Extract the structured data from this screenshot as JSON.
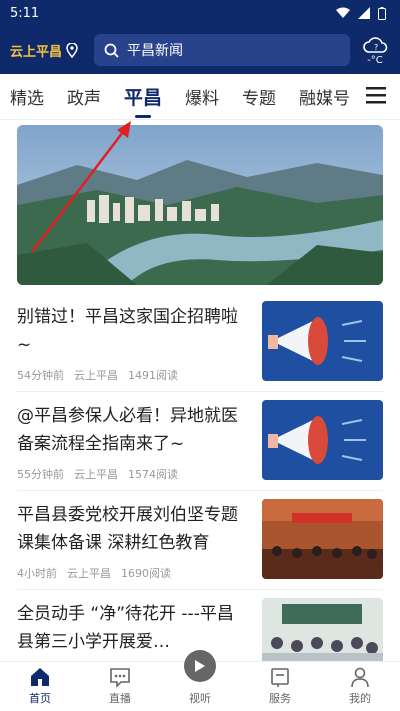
{
  "status_bar": {
    "time": "5:11"
  },
  "header": {
    "logo_text": "云上平昌",
    "search_placeholder": "平昌新闻",
    "weather_temp": "-°C"
  },
  "tabs": [
    {
      "label": "精选"
    },
    {
      "label": "政声"
    },
    {
      "label": "平昌",
      "active": true
    },
    {
      "label": "爆料"
    },
    {
      "label": "专题"
    },
    {
      "label": "融媒号"
    }
  ],
  "news": [
    {
      "title": "别错过！平昌这家国企招聘啦~",
      "time": "54分钟前",
      "source": "云上平昌",
      "reads": "1491阅读"
    },
    {
      "title": "@平昌参保人必看！异地就医备案流程全指南来了~",
      "time": "55分钟前",
      "source": "云上平昌",
      "reads": "1574阅读"
    },
    {
      "title": "平昌县委党校开展刘伯坚专题课集体备课 深耕红色教育",
      "time": "4小时前",
      "source": "云上平昌",
      "reads": "1690阅读"
    },
    {
      "title": "全员动手 “净”待花开 ---平昌县第三小学开展爱…",
      "time": "",
      "source": "",
      "reads": ""
    }
  ],
  "bottom_nav": [
    {
      "label": "首页",
      "active": true
    },
    {
      "label": "直播"
    },
    {
      "label": "视听"
    },
    {
      "label": "服务"
    },
    {
      "label": "我的"
    }
  ]
}
